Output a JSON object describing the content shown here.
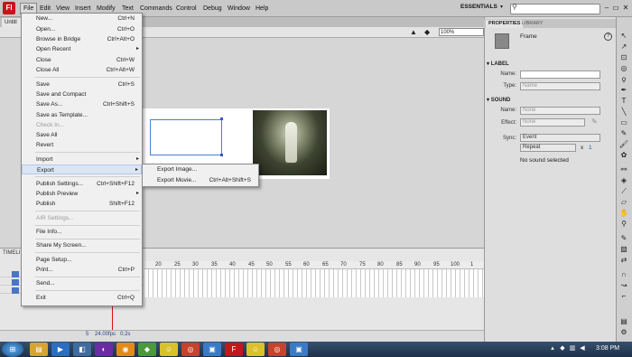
{
  "app": {
    "logo": "Fl",
    "essentials": "ESSENTIALS"
  },
  "menubar": [
    "File",
    "Edit",
    "View",
    "Insert",
    "Modify",
    "Text",
    "Commands",
    "Control",
    "Debug",
    "Window",
    "Help"
  ],
  "window_buttons": [
    "–",
    "▭",
    "✕"
  ],
  "doc_tab": "Untitl",
  "zoom": "100%",
  "file_menu": [
    {
      "label": "New...",
      "shortcut": "Ctrl+N"
    },
    {
      "label": "Open...",
      "shortcut": "Ctrl+O"
    },
    {
      "label": "Browse in Bridge",
      "shortcut": "Ctrl+Alt+O"
    },
    {
      "label": "Open Recent",
      "shortcut": "",
      "submenu": true
    },
    {
      "label": "Close",
      "shortcut": "Ctrl+W"
    },
    {
      "label": "Close All",
      "shortcut": "Ctrl+Alt+W"
    },
    {
      "label": "Save",
      "shortcut": "Ctrl+S"
    },
    {
      "label": "Save and Compact",
      "shortcut": ""
    },
    {
      "label": "Save As...",
      "shortcut": "Ctrl+Shift+S"
    },
    {
      "label": "Save as Template...",
      "shortcut": ""
    },
    {
      "label": "Check In...",
      "shortcut": "",
      "disabled": true
    },
    {
      "label": "Save All",
      "shortcut": ""
    },
    {
      "label": "Revert",
      "shortcut": ""
    },
    {
      "label": "Import",
      "shortcut": "",
      "submenu": true
    },
    {
      "label": "Export",
      "shortcut": "",
      "submenu": true,
      "highlighted": true
    },
    {
      "label": "Publish Settings...",
      "shortcut": "Ctrl+Shift+F12"
    },
    {
      "label": "Publish Preview",
      "shortcut": "",
      "submenu": true
    },
    {
      "label": "Publish",
      "shortcut": "Shift+F12"
    },
    {
      "label": "AIR Settings...",
      "shortcut": "",
      "disabled": true
    },
    {
      "label": "File Info...",
      "shortcut": ""
    },
    {
      "label": "Share My Screen...",
      "shortcut": ""
    },
    {
      "label": "Page Setup...",
      "shortcut": ""
    },
    {
      "label": "Print...",
      "shortcut": "Ctrl+P"
    },
    {
      "label": "Send...",
      "shortcut": ""
    },
    {
      "label": "Exit",
      "shortcut": "Ctrl+Q"
    }
  ],
  "export_submenu": [
    {
      "label": "Export Image...",
      "shortcut": ""
    },
    {
      "label": "Export Movie...",
      "shortcut": "Ctrl+Alt+Shift+S"
    }
  ],
  "timeline": {
    "tab": "TIMELI",
    "ticks": [
      "20",
      "25",
      "30",
      "35",
      "40",
      "45",
      "50",
      "55",
      "60",
      "65",
      "70",
      "75",
      "80",
      "85",
      "90",
      "95",
      "100",
      "1"
    ],
    "fps": "24.00",
    "fps_unit": "fps",
    "time": "0.2s",
    "frame": "5"
  },
  "properties": {
    "tabs": [
      "PROPERTIES",
      "LIBRARY"
    ],
    "frame_label": "Frame",
    "label_section": "LABEL",
    "name_label": "Name:",
    "type_label": "Type:",
    "type_value": "Name",
    "sound_section": "SOUND",
    "sound_name_label": "Name:",
    "sound_name_value": "None",
    "effect_label": "Effect:",
    "effect_value": "None",
    "sync_label": "Sync:",
    "sync_value": "Event",
    "repeat_value": "Repeat",
    "repeat_x": "x",
    "repeat_count": "1",
    "no_sound": "No sound selected"
  },
  "taskbar": {
    "start": "⊞",
    "clock": "3:08 PM"
  }
}
